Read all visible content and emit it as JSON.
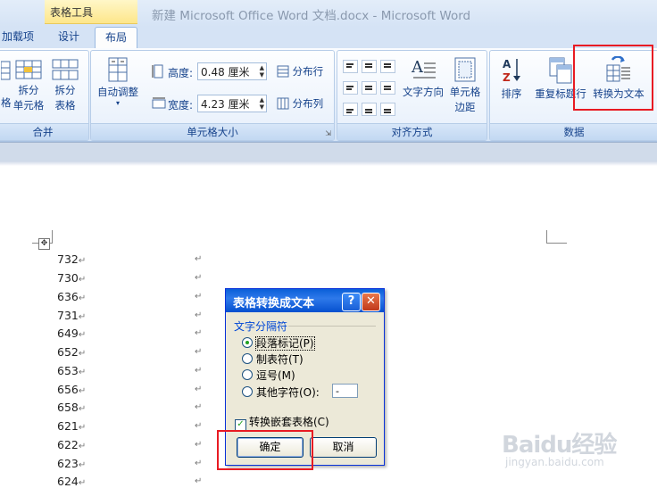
{
  "window": {
    "context_tab": "表格工具",
    "title": "新建 Microsoft Office Word 文档.docx - Microsoft Word"
  },
  "tabs": [
    {
      "label": "加载项"
    },
    {
      "label": "设计"
    },
    {
      "label": "布局",
      "active": true
    }
  ],
  "ribbon": {
    "merge_group": {
      "label": "合并",
      "partial_left_text": [
        "格"
      ],
      "split_cells": "拆分\n单元格",
      "split_cells_l1": "拆分",
      "split_cells_l2": "单元格",
      "split_table_l1": "拆分",
      "split_table_l2": "表格"
    },
    "cell_size_group": {
      "label": "单元格大小",
      "auto_fit": "自动调整",
      "height_label": "高度:",
      "height_value": "0.48 厘米",
      "width_label": "宽度:",
      "width_value": "4.23 厘米",
      "distribute_rows": "分布行",
      "distribute_cols": "分布列"
    },
    "alignment_group": {
      "label": "对齐方式",
      "text_direction": "文字方向",
      "cell_margins_l1": "单元格",
      "cell_margins_l2": "边距"
    },
    "data_group": {
      "label": "数据",
      "sort": "排序",
      "repeat_header": "重复标题行",
      "convert_to_text": "转换为文本"
    }
  },
  "document": {
    "rows": [
      "732",
      "730",
      "636",
      "731",
      "649",
      "652",
      "653",
      "656",
      "658",
      "621",
      "622",
      "623",
      "624"
    ],
    "paragraph_mark": "↵"
  },
  "dialog": {
    "title": "表格转换成文本",
    "separator_group": "文字分隔符",
    "options": [
      {
        "label": "段落标记(P)",
        "selected": true
      },
      {
        "label": "制表符(T)",
        "selected": false
      },
      {
        "label": "逗号(M)",
        "selected": false
      },
      {
        "label": "其他字符(O):",
        "selected": false
      }
    ],
    "other_char_value": "-",
    "nested_tables_label": "转换嵌套表格(C)",
    "nested_tables_checked": true,
    "ok_label": "确定",
    "cancel_label": "取消",
    "help_glyph": "?",
    "close_glyph": "✕"
  },
  "watermark": {
    "brand": "Baidu经验",
    "url": "jingyan.baidu.com"
  },
  "colors": {
    "highlight": "#e81b23",
    "dialog_title": "#0a5fd8"
  }
}
